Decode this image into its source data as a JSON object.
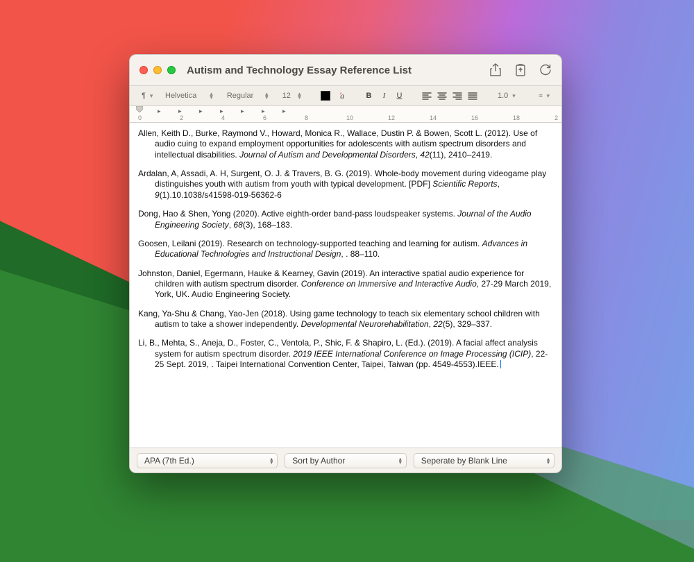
{
  "window": {
    "title": "Autism and Technology Essay Reference List"
  },
  "toolbar": {
    "para_symbol": "¶",
    "font_family": "Helvetica",
    "font_weight": "Regular",
    "font_size": "12",
    "line_height": "1.0"
  },
  "ruler": {
    "labels": [
      "0",
      "2",
      "4",
      "6",
      "8",
      "10",
      "12",
      "14",
      "16",
      "18",
      "2"
    ]
  },
  "refs": [
    {
      "plain_a": "Allen, Keith D., Burke, Raymond V., Howard, Monica R., Wallace, Dustin P. & Bowen, Scott L. (2012). Use of audio cuing to expand employment opportunities for adolescents with autism spectrum disorders and intellectual disabilities. ",
      "ital_a": "Journal of Autism and Developmental Disorders",
      "plain_b": ", ",
      "ital_b": "42",
      "plain_c": "(11), 2410–2419."
    },
    {
      "plain_a": "Ardalan, A, Assadi, A. H, Surgent, O. J. & Travers, B. G. (2019). Whole-body movement during videogame play distinguishes youth with autism from youth with typical development. [PDF] ",
      "ital_a": "Scientific Reports",
      "plain_b": ", ",
      "ital_b": "9",
      "plain_c": "(1).10.1038/s41598-019-56362-6"
    },
    {
      "plain_a": "Dong, Hao & Shen, Yong (2020). Active eighth-order band-pass loudspeaker systems. ",
      "ital_a": "Journal of the Audio Engineering Society",
      "plain_b": ", ",
      "ital_b": "68",
      "plain_c": "(3), 168–183."
    },
    {
      "plain_a": "Goosen, Leilani (2019). Research on technology-supported teaching and learning for autism. ",
      "ital_a": "Advances in Educational Technologies and Instructional Design",
      "plain_b": ", . 88–110.",
      "ital_b": "",
      "plain_c": ""
    },
    {
      "plain_a": "Johnston, Daniel, Egermann, Hauke & Kearney, Gavin (2019). An interactive spatial audio experience for children with autism spectrum disorder. ",
      "ital_a": "Conference on Immersive and Interactive Audio",
      "plain_b": ", 27-29 March 2019, York, UK. Audio Engineering Society.",
      "ital_b": "",
      "plain_c": ""
    },
    {
      "plain_a": "Kang, Ya-Shu & Chang, Yao-Jen (2018). Using game technology to teach six elementary school children with autism to take a shower independently. ",
      "ital_a": "Developmental Neurorehabilitation",
      "plain_b": ", ",
      "ital_b": "22",
      "plain_c": "(5), 329–337."
    },
    {
      "plain_a": "Li, B., Mehta, S., Aneja, D., Foster, C., Ventola, P., Shic, F. & Shapiro, L. (Ed.). (2019). A facial affect analysis system for autism spectrum disorder. ",
      "ital_a": "2019 IEEE International Conference on Image Processing (ICIP)",
      "plain_b": ", 22-25 Sept. 2019, . Taipei International Convention Center, Taipei, Taiwan (pp. 4549-4553).IEEE.",
      "ital_b": "",
      "plain_c": ""
    }
  ],
  "footer": {
    "style_select": "APA (7th Ed.)",
    "sort_select": "Sort by Author",
    "sep_select": "Seperate by Blank Line"
  }
}
